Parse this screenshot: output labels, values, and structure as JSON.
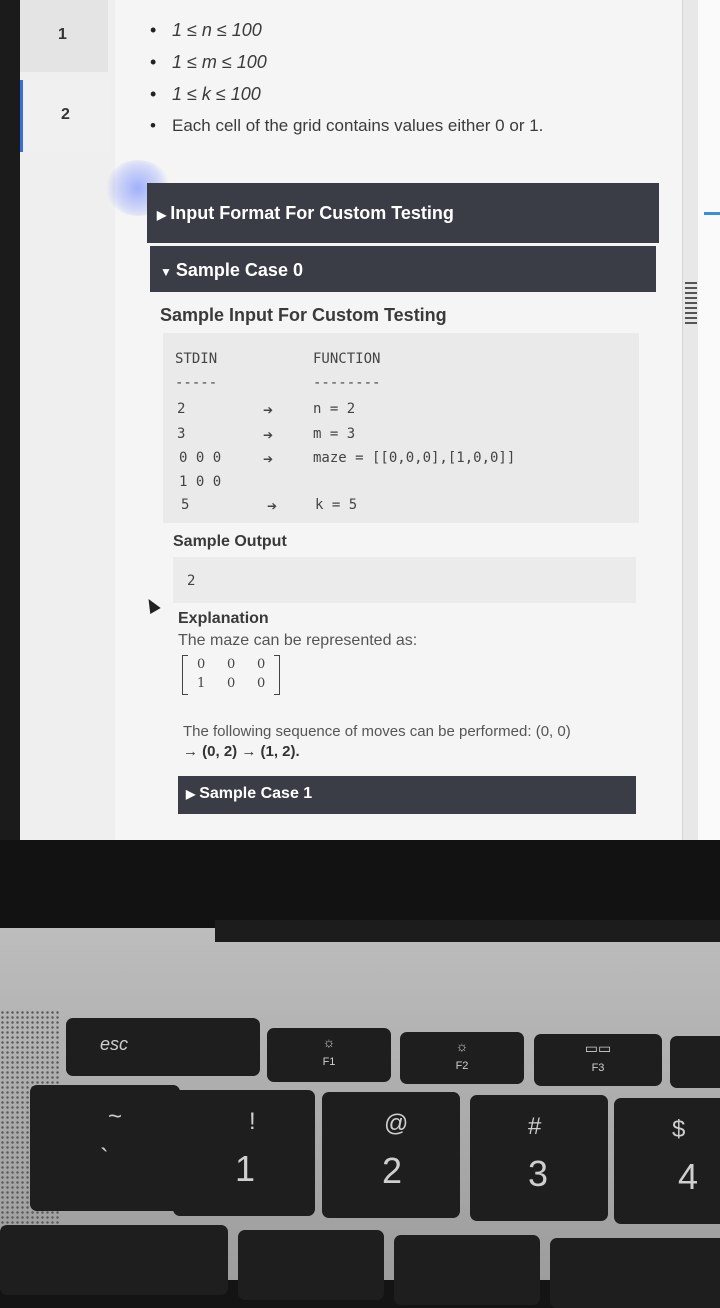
{
  "question_nav": {
    "items": [
      "1",
      "2"
    ],
    "active_index": 1
  },
  "constraints": [
    "1 ≤ n ≤ 100",
    "1 ≤ m ≤ 100",
    "1 ≤ k ≤ 100",
    "Each cell of the grid contains values either 0 or 1."
  ],
  "sections": {
    "input_format": "Input Format For Custom Testing",
    "sample_case_0": "Sample Case 0",
    "sample_case_1": "Sample Case 1"
  },
  "sample_input": {
    "heading": "Sample Input For Custom Testing",
    "col_stdin": "STDIN",
    "col_function": "FUNCTION",
    "stdin_underline": "-----",
    "function_underline": "--------",
    "rows": [
      {
        "stdin": "2",
        "function": "n = 2"
      },
      {
        "stdin": "3",
        "function": "m = 3"
      },
      {
        "stdin": "0 0 0",
        "function": "maze = [[0,0,0],[1,0,0]]"
      },
      {
        "stdin": "1 0 0",
        "function": ""
      },
      {
        "stdin": "5",
        "function": "k = 5"
      }
    ]
  },
  "sample_output": {
    "heading": "Sample Output",
    "value": "2"
  },
  "explanation": {
    "heading": "Explanation",
    "text": "The maze can be represented as:",
    "matrix": [
      [
        "0",
        "0",
        "0"
      ],
      [
        "1",
        "0",
        "0"
      ]
    ],
    "sequence_line1": "The following sequence of moves can be performed: (0, 0)",
    "sequence_line2": "→ (0, 2) → (1, 2)."
  },
  "keyboard": {
    "esc": "esc",
    "f1": {
      "icon": "☼",
      "label": "F1"
    },
    "f2": {
      "icon": "☼",
      "label": "F2"
    },
    "f3": {
      "icon": "▭▭",
      "label": "F3"
    },
    "row_numbers": [
      {
        "top": "~",
        "bottom": "`"
      },
      {
        "top": "!",
        "bottom": "1"
      },
      {
        "top": "@",
        "bottom": "2"
      },
      {
        "top": "#",
        "bottom": "3"
      },
      {
        "top": "$",
        "bottom": "4"
      }
    ]
  }
}
